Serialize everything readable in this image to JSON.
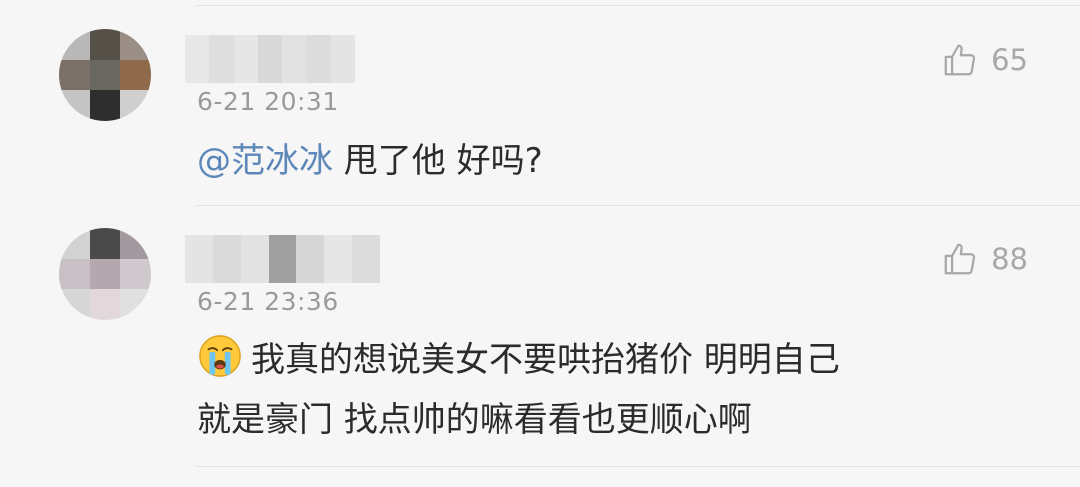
{
  "comments": [
    {
      "timestamp": "6-21 20:31",
      "likes": "65",
      "mention": "@范冰冰",
      "text": " 甩了他 好吗?",
      "avatar_colors": [
        "#b8b8b8",
        "#555048",
        "#9a8e86",
        "#7a7068",
        "#686860",
        "#8e6a4a",
        "#c4c4c4",
        "#2e2e2e",
        "#cfcfcf"
      ],
      "name_blur_colors": [
        "#e8e8e8",
        "#dedede",
        "#e6e6e6",
        "#d8d8d8",
        "#e2e2e2",
        "#dcdcdc",
        "#e4e4e4"
      ]
    },
    {
      "timestamp": "6-21 23:36",
      "likes": "88",
      "emoji": "crying-face-icon",
      "lines": [
        "我真的想说美女不要哄抬猪价 明明自己",
        "就是豪门 找点帅的嘛看看也更顺心啊"
      ],
      "avatar_colors": [
        "#d2d2d2",
        "#4a4a4a",
        "#a39aa0",
        "#c8c0c4",
        "#b4a8ae",
        "#cfc8cc",
        "#d6d6d6",
        "#e2d8dc",
        "#e0e0e0"
      ],
      "name_blur_colors": [
        "#e4e4e4",
        "#dadada",
        "#e2e2e2",
        "#a0a0a0",
        "#d6d6d6",
        "#e6e6e6",
        "#dcdcdc"
      ]
    }
  ]
}
